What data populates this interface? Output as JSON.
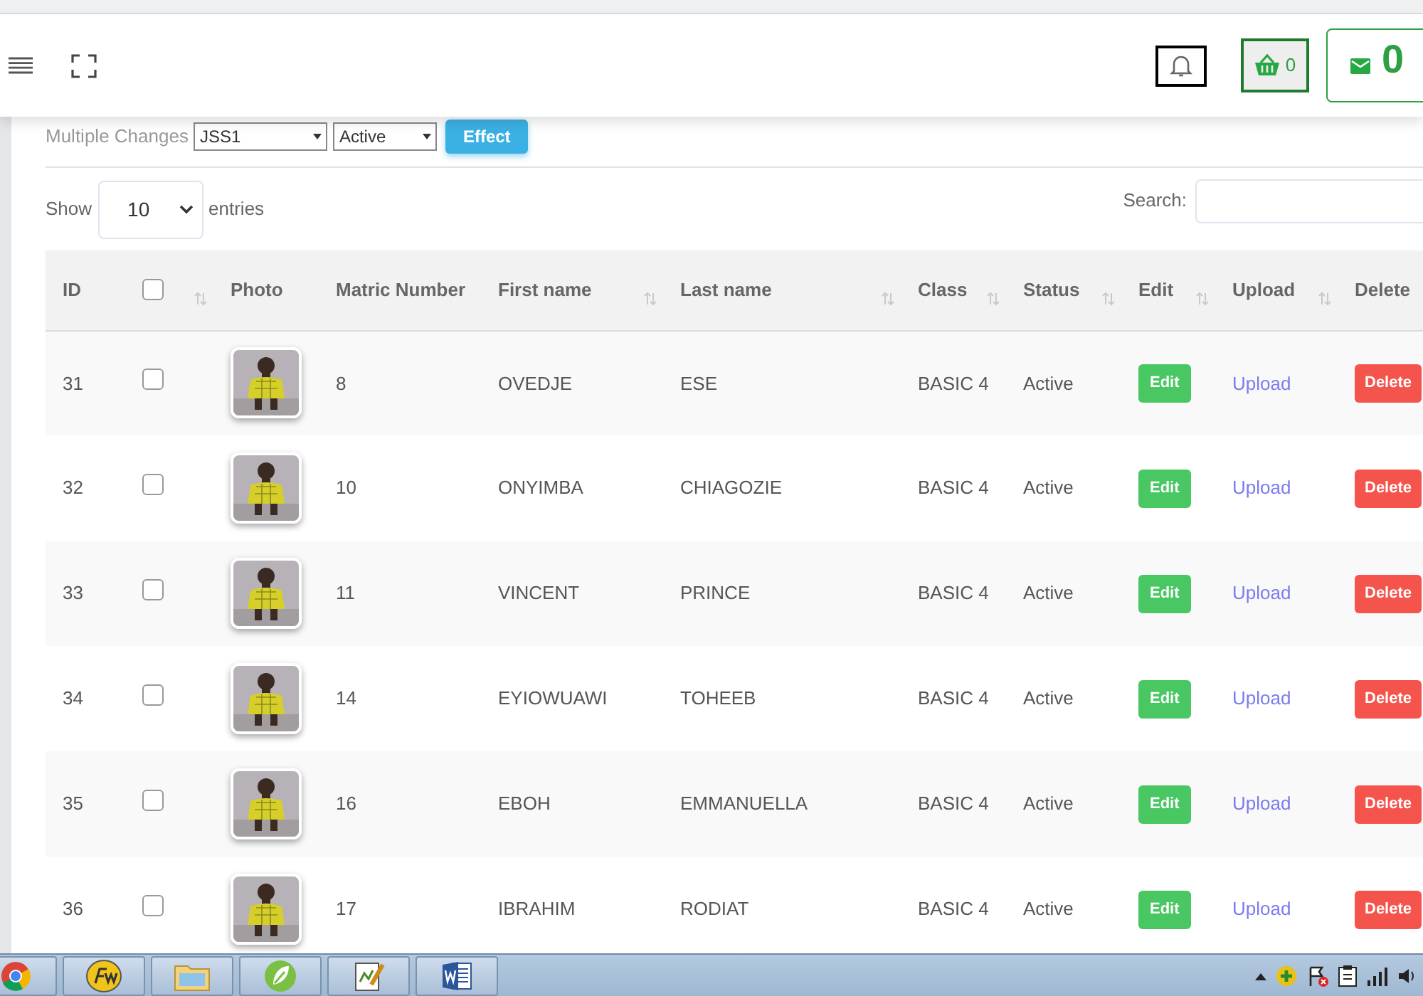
{
  "header": {
    "cart_count": "0",
    "messages_count": "0"
  },
  "bulk": {
    "label": "Multiple Changes",
    "class_value": "JSS1",
    "status_value": "Active",
    "button": "Effect"
  },
  "length": {
    "show": "Show",
    "value": "10",
    "entries": "entries"
  },
  "search": {
    "label": "Search:"
  },
  "columns": [
    {
      "label": "ID",
      "kind": "text",
      "sortable": false
    },
    {
      "kind": "checkbox",
      "checked": false,
      "sortable": true
    },
    {
      "label": "Photo",
      "kind": "text",
      "sortable": false
    },
    {
      "label": "Matric Number",
      "kind": "text",
      "sortable": false
    },
    {
      "label": "First name",
      "kind": "text",
      "sortable": true
    },
    {
      "label": "Last name",
      "kind": "text",
      "sortable": true
    },
    {
      "label": "Class",
      "kind": "text",
      "sortable": true
    },
    {
      "label": "Status",
      "kind": "text",
      "sortable": true
    },
    {
      "label": "Edit",
      "kind": "text",
      "sortable": true
    },
    {
      "label": "Upload",
      "kind": "text",
      "sortable": true
    },
    {
      "label": "Delete",
      "kind": "text"
    }
  ],
  "rows": [
    {
      "id": "31",
      "checked": false,
      "matric": "8",
      "first": "OVEDJE",
      "last": "ESE",
      "class": "BASIC 4",
      "status": "Active",
      "edit": "Edit",
      "upload": "Upload",
      "delete": "Delete"
    },
    {
      "id": "32",
      "checked": false,
      "matric": "10",
      "first": "ONYIMBA",
      "last": "CHIAGOZIE",
      "class": "BASIC 4",
      "status": "Active",
      "edit": "Edit",
      "upload": "Upload",
      "delete": "Delete"
    },
    {
      "id": "33",
      "checked": false,
      "matric": "11",
      "first": "VINCENT",
      "last": "PRINCE",
      "class": "BASIC 4",
      "status": "Active",
      "edit": "Edit",
      "upload": "Upload",
      "delete": "Delete"
    },
    {
      "id": "34",
      "checked": false,
      "matric": "14",
      "first": "EYIOWUAWI",
      "last": "TOHEEB",
      "class": "BASIC 4",
      "status": "Active",
      "edit": "Edit",
      "upload": "Upload",
      "delete": "Delete"
    },
    {
      "id": "35",
      "checked": false,
      "matric": "16",
      "first": "EBOH",
      "last": "EMMANUELLA",
      "class": "BASIC 4",
      "status": "Active",
      "edit": "Edit",
      "upload": "Upload",
      "delete": "Delete"
    },
    {
      "id": "36",
      "checked": false,
      "matric": "17",
      "first": "IBRAHIM",
      "last": "RODIAT",
      "class": "BASIC 4",
      "status": "Active",
      "edit": "Edit",
      "upload": "Upload",
      "delete": "Delete"
    }
  ],
  "taskbar": [
    {
      "kind": "chrome"
    },
    {
      "kind": "fw"
    },
    {
      "kind": "folder"
    },
    {
      "kind": "leaf"
    },
    {
      "kind": "notepad"
    },
    {
      "kind": "word"
    }
  ]
}
